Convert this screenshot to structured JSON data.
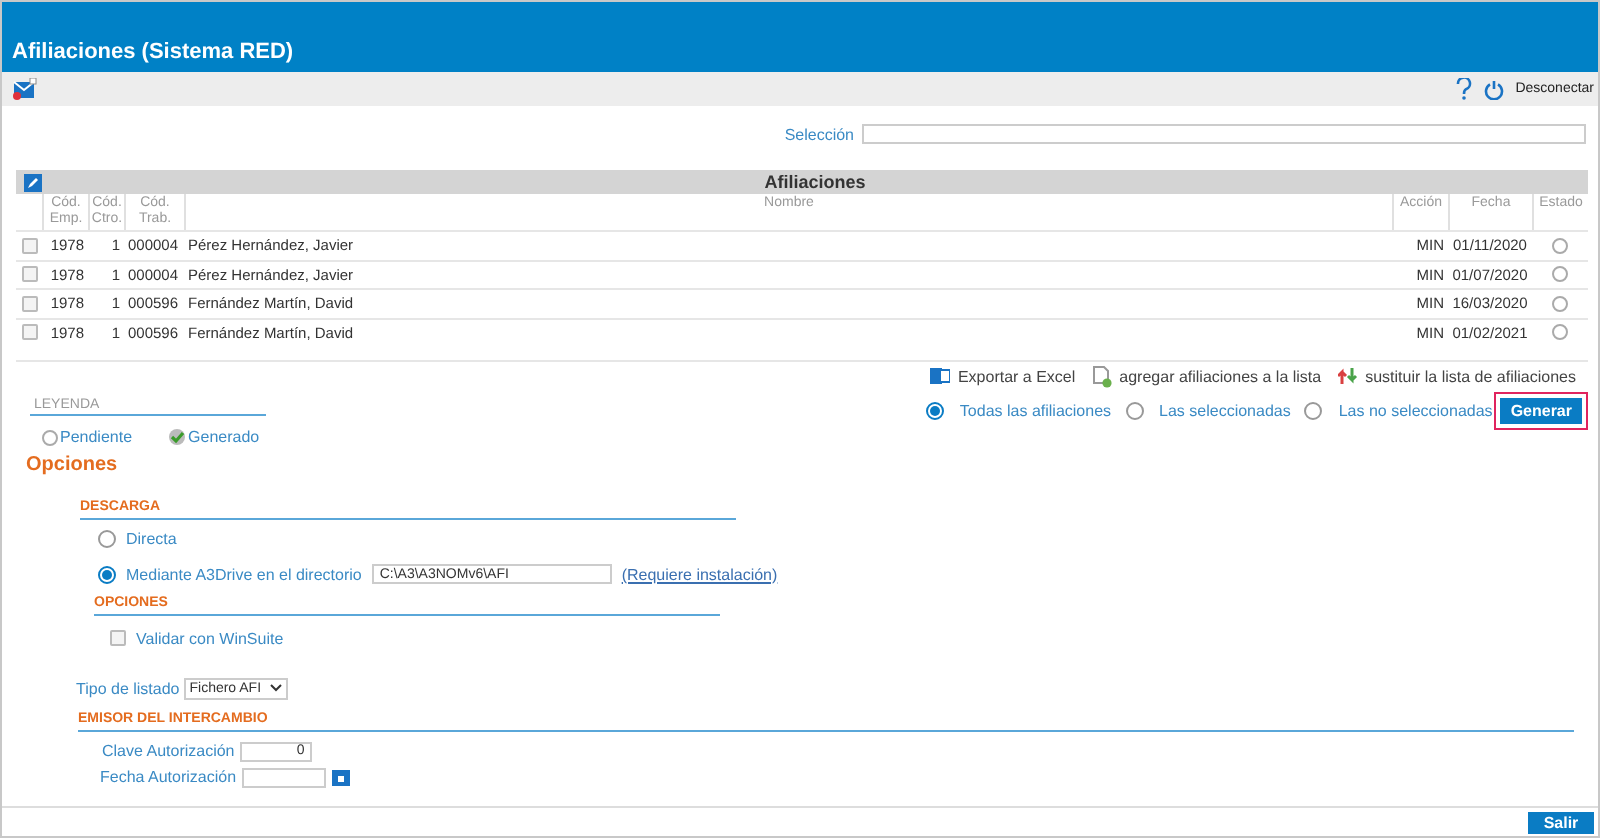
{
  "window": {
    "title": "Afiliaciones (Sistema RED)"
  },
  "toolbar": {
    "disconnect": "Desconectar"
  },
  "selection": {
    "label": "Selección"
  },
  "table": {
    "title": "Afiliaciones",
    "columns": [
      "Cód. Emp.",
      "Cód. Ctro.",
      "Cód. Trab.",
      "Nombre",
      "Acción",
      "Fecha",
      "Estado"
    ],
    "rows": [
      {
        "checked": false,
        "cells": [
          "1978",
          "1",
          "000004",
          "Pérez Hernández, Javier",
          "MIN",
          "01/11/2020"
        ],
        "kind": "pending"
      },
      {
        "checked": false,
        "cells": [
          "1978",
          "1",
          "000004",
          "Pérez Hernández, Javier",
          "MIN",
          "01/07/2020"
        ],
        "kind": "pending"
      },
      {
        "checked": false,
        "cells": [
          "1978",
          "1",
          "000596",
          "Fernández Martín, David",
          "MIN",
          "16/03/2020"
        ],
        "kind": "pending"
      },
      {
        "checked": false,
        "cells": [
          "1978",
          "1",
          "000596",
          "Fernández Martín, David",
          "MIN",
          "01/02/2021"
        ],
        "kind": "pending"
      }
    ]
  },
  "actions": [
    {
      "kind": "excel",
      "label": "Exportar a Excel"
    },
    {
      "kind": "add",
      "label": "agregar afiliaciones a la lista"
    },
    {
      "kind": "replace",
      "label": "sustituir la lista de afiliaciones"
    }
  ],
  "scope": [
    {
      "label": "Todas las afiliaciones",
      "selected": true
    },
    {
      "label": "Las seleccionadas",
      "selected": false
    },
    {
      "label": "Las no seleccionadas",
      "selected": false
    }
  ],
  "generate": {
    "label": "Generar",
    "highlighted": true
  },
  "legend": {
    "title": "LEYENDA",
    "items": [
      {
        "label": "Pendiente",
        "kind": "pending"
      },
      {
        "label": "Generado",
        "kind": "generated"
      }
    ]
  },
  "options": {
    "title": "Opciones",
    "download": {
      "title": "DESCARGA",
      "choices": [
        {
          "label": "Directa",
          "selected": false
        },
        {
          "label": "Mediante A3Drive en el directorio",
          "selected": true
        }
      ],
      "directory": "C:\\A3\\A3NOMv6\\AFI",
      "install_link": "(Requiere instalación)"
    },
    "sub_title": "OPCIONES",
    "validate": {
      "label": "Validar con WinSuite",
      "checked": false
    },
    "list_type": {
      "label": "Tipo de listado",
      "value": "Fichero AFI"
    },
    "issuer": {
      "title": "EMISOR DEL INTERCAMBIO",
      "key": {
        "label": "Clave Autorización",
        "value": "0"
      },
      "date": {
        "label": "Fecha Autorización"
      }
    }
  },
  "footer": {
    "exit": "Salir"
  }
}
